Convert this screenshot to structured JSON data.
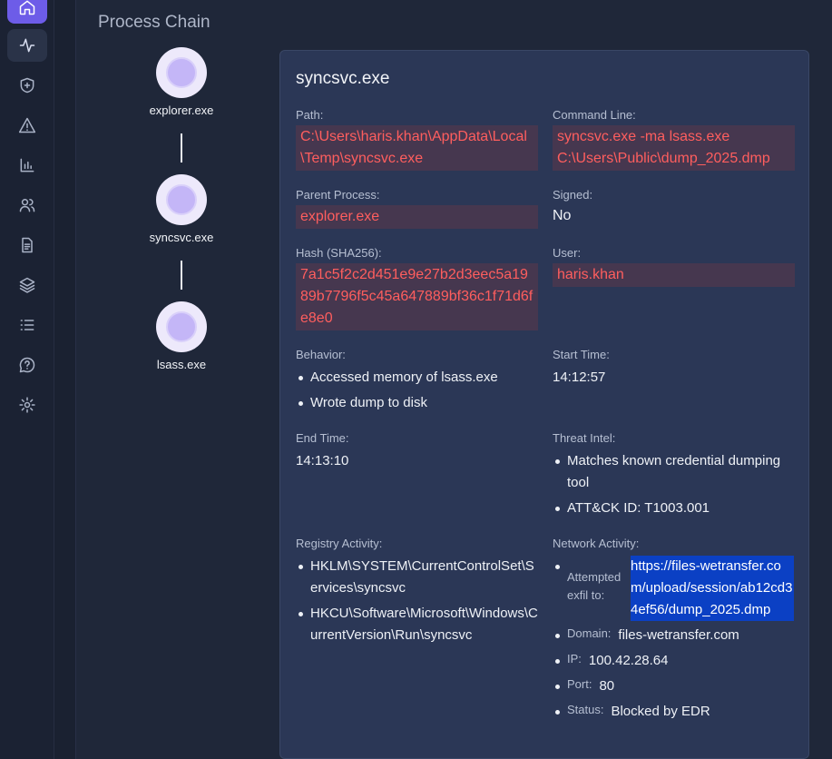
{
  "page": {
    "section_title": "Process Chain"
  },
  "sidebar": {
    "icons": [
      "home-icon",
      "activity-icon",
      "shield-plus-icon",
      "alert-triangle-icon",
      "bar-chart-icon",
      "users-icon",
      "file-text-icon",
      "layers-icon",
      "list-icon",
      "help-circle-icon",
      "gear-icon"
    ]
  },
  "chain": {
    "nodes": [
      {
        "label": "explorer.exe"
      },
      {
        "label": "syncsvc.exe"
      },
      {
        "label": "lsass.exe"
      }
    ]
  },
  "details": {
    "title": "syncsvc.exe",
    "path_label": "Path:",
    "path": "C:\\Users\\haris.khan\\AppData\\Local\\Temp\\syncsvc.exe",
    "cmdline_label": "Command Line:",
    "cmdline": "syncsvc.exe -ma lsass.exe C:\\Users\\Public\\dump_2025.dmp",
    "parent_label": "Parent Process:",
    "parent": "explorer.exe",
    "signed_label": "Signed:",
    "signed": "No",
    "hash_label": "Hash (SHA256):",
    "hash": "7a1c5f2c2d451e9e27b2d3eec5a1989b7796f5c45a647889bf36c1f71d6fe8e0",
    "user_label": "User:",
    "user": "haris.khan",
    "behavior_label": "Behavior:",
    "behavior": [
      "Accessed memory of lsass.exe",
      "Wrote dump to disk"
    ],
    "start_label": "Start Time:",
    "start": "14:12:57",
    "end_label": "End Time:",
    "end": "14:13:10",
    "intel_label": "Threat Intel:",
    "intel": [
      "Matches known credential dumping tool",
      "ATT&CK ID: T1003.001"
    ],
    "registry_label": "Registry Activity:",
    "registry": [
      "HKLM\\SYSTEM\\CurrentControlSet\\Services\\syncsvc",
      "HKCU\\Software\\Microsoft\\Windows\\CurrentVersion\\Run\\syncsvc"
    ],
    "network_label": "Network Activity:",
    "network": {
      "exfil_key": "Attempted exfil to:",
      "exfil_url": "https://files-wetransfer.com/upload/session/ab12cd34ef56/dump_2025.dmp",
      "domain_key": "Domain:",
      "domain": "files-wetransfer.com",
      "ip_key": "IP:",
      "ip": "100.42.28.64",
      "port_key": "Port:",
      "port": "80",
      "status_key": "Status:",
      "status": "Blocked by EDR"
    }
  },
  "colors": {
    "accent": "#6d5ce8",
    "highlight_text": "#ff5e5e",
    "url_highlight": "#0b40c4"
  }
}
